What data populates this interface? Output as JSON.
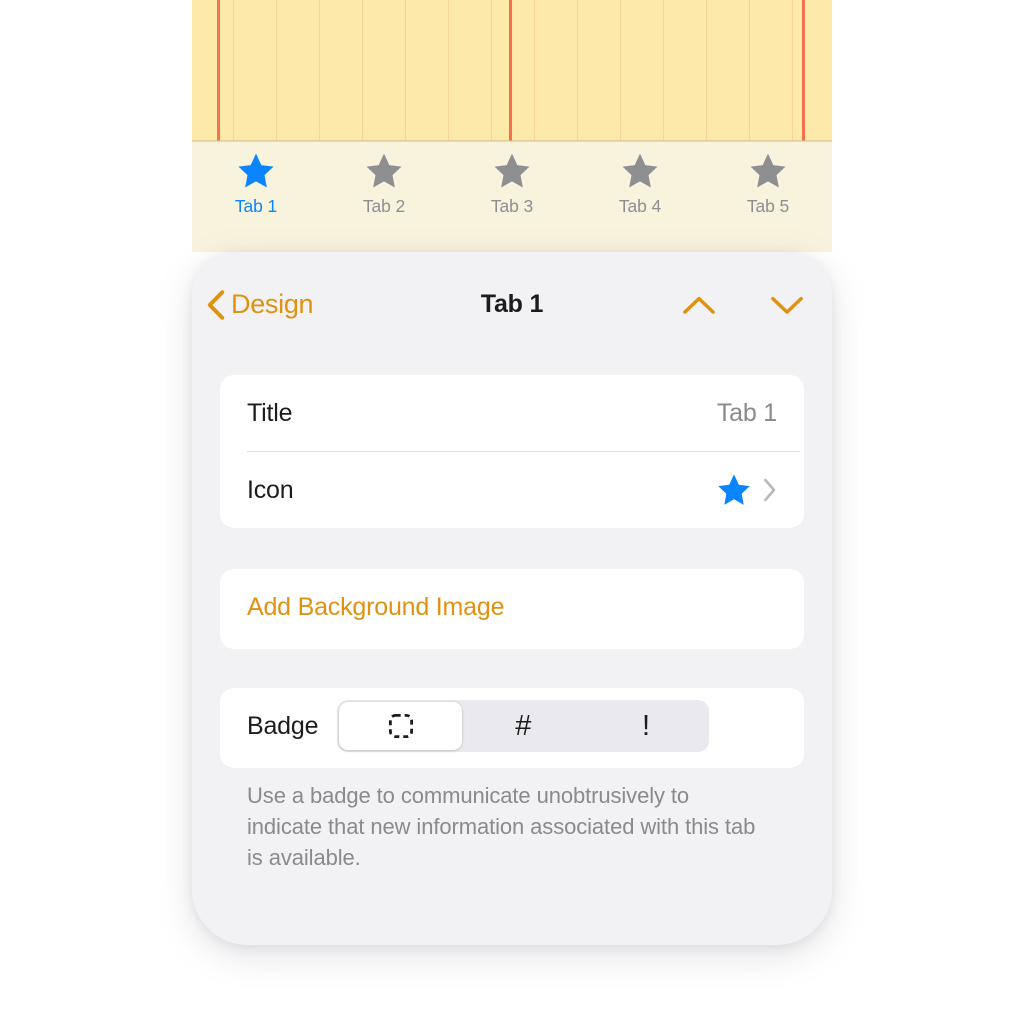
{
  "notepad": {
    "description": "lined yellow notepad background",
    "paper_color": "#FDE9A9",
    "rule_line_color": "#F4704E"
  },
  "tabbar": {
    "background_color": "#F8F3DD",
    "active_color": "#0A84FF",
    "inactive_color": "#8E8E93",
    "items": [
      {
        "label": "Tab 1",
        "icon": "star-icon",
        "selected": true
      },
      {
        "label": "Tab 2",
        "icon": "star-icon",
        "selected": false
      },
      {
        "label": "Tab 3",
        "icon": "star-icon",
        "selected": false
      },
      {
        "label": "Tab 4",
        "icon": "star-icon",
        "selected": false
      },
      {
        "label": "Tab 5",
        "icon": "star-icon",
        "selected": false
      }
    ]
  },
  "sheet": {
    "accent_color": "#E0920F",
    "background_color": "#F2F2F5",
    "header": {
      "back_label": "Design",
      "back_icon": "chevron-left-icon",
      "title": "Tab 1",
      "previous_icon": "chevron-up-icon",
      "next_icon": "chevron-down-icon"
    },
    "info_card": {
      "rows": [
        {
          "label": "Title",
          "value": "Tab 1"
        },
        {
          "label": "Icon",
          "value": "",
          "icon": "star-icon",
          "accessory": "chevron-right-icon"
        }
      ]
    },
    "background_image_card": {
      "action_label": "Add Background Image"
    },
    "badge_card": {
      "label": "Badge",
      "options": [
        {
          "id": "none",
          "icon": "dashed-square-icon",
          "glyph": "",
          "selected": true
        },
        {
          "id": "number",
          "icon": "hash-icon",
          "glyph": "#",
          "selected": false
        },
        {
          "id": "exclamation",
          "icon": "exclamation-icon",
          "glyph": "!",
          "selected": false
        }
      ]
    },
    "footnote": "Use a badge to communicate unobtrusively to indicate that new information associated with this tab is available."
  }
}
